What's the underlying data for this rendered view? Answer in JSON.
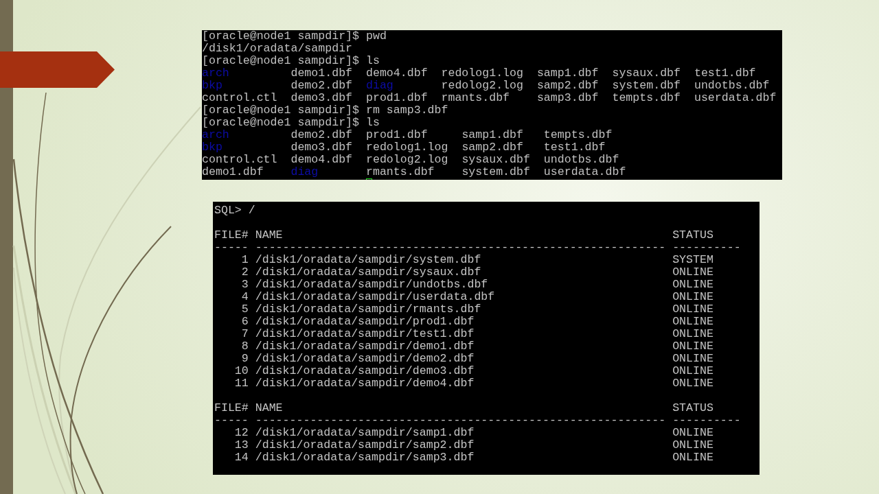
{
  "terminal": {
    "lines": [
      {
        "kind": "text",
        "text": "[oracle@node1 sampdir]$ pwd"
      },
      {
        "kind": "text",
        "text": "/disk1/oradata/sampdir"
      },
      {
        "kind": "text",
        "text": "[oracle@node1 sampdir]$ ls"
      },
      {
        "kind": "listing",
        "rows": [
          [
            {
              "name": "arch",
              "kind": "directory"
            },
            {
              "name": "demo1.dbf",
              "kind": "file"
            },
            {
              "name": "demo4.dbf",
              "kind": "file"
            },
            {
              "name": "redolog1.log",
              "kind": "file"
            },
            {
              "name": "samp1.dbf",
              "kind": "file"
            },
            {
              "name": "sysaux.dbf",
              "kind": "file"
            },
            {
              "name": "test1.dbf",
              "kind": "file"
            }
          ],
          [
            {
              "name": "bkp",
              "kind": "directory"
            },
            {
              "name": "demo2.dbf",
              "kind": "file"
            },
            {
              "name": "diag",
              "kind": "directory"
            },
            {
              "name": "redolog2.log",
              "kind": "file"
            },
            {
              "name": "samp2.dbf",
              "kind": "file"
            },
            {
              "name": "system.dbf",
              "kind": "file"
            },
            {
              "name": "undotbs.dbf",
              "kind": "file"
            }
          ],
          [
            {
              "name": "control.ctl",
              "kind": "file"
            },
            {
              "name": "demo3.dbf",
              "kind": "file"
            },
            {
              "name": "prod1.dbf",
              "kind": "file"
            },
            {
              "name": "rmants.dbf",
              "kind": "file"
            },
            {
              "name": "samp3.dbf",
              "kind": "file"
            },
            {
              "name": "tempts.dbf",
              "kind": "file"
            },
            {
              "name": "userdata.dbf",
              "kind": "file"
            }
          ]
        ]
      },
      {
        "kind": "text",
        "text": "[oracle@node1 sampdir]$ rm samp3.dbf"
      },
      {
        "kind": "text",
        "text": "[oracle@node1 sampdir]$ ls"
      },
      {
        "kind": "listing",
        "rows": [
          [
            {
              "name": "arch",
              "kind": "directory"
            },
            {
              "name": "demo2.dbf",
              "kind": "file"
            },
            {
              "name": "prod1.dbf",
              "kind": "file"
            },
            {
              "name": "samp1.dbf",
              "kind": "file"
            },
            {
              "name": "tempts.dbf",
              "kind": "file"
            }
          ],
          [
            {
              "name": "bkp",
              "kind": "directory"
            },
            {
              "name": "demo3.dbf",
              "kind": "file"
            },
            {
              "name": "redolog1.log",
              "kind": "file"
            },
            {
              "name": "samp2.dbf",
              "kind": "file"
            },
            {
              "name": "test1.dbf",
              "kind": "file"
            }
          ],
          [
            {
              "name": "control.ctl",
              "kind": "file"
            },
            {
              "name": "demo4.dbf",
              "kind": "file"
            },
            {
              "name": "redolog2.log",
              "kind": "file"
            },
            {
              "name": "sysaux.dbf",
              "kind": "file"
            },
            {
              "name": "undotbs.dbf",
              "kind": "file"
            }
          ],
          [
            {
              "name": "demo1.dbf",
              "kind": "file"
            },
            {
              "name": "diag",
              "kind": "directory"
            },
            {
              "name": "rmants.dbf",
              "kind": "file"
            },
            {
              "name": "system.dbf",
              "kind": "file"
            },
            {
              "name": "userdata.dbf",
              "kind": "file"
            }
          ]
        ]
      },
      {
        "kind": "cursor"
      }
    ]
  },
  "sql": {
    "prompt": "SQL> /",
    "result_blocks": [
      {
        "headers": {
          "file_no": "FILE#",
          "name": "NAME",
          "status": "STATUS"
        },
        "rules": {
          "file_no": "-----",
          "name": "------------------------------------------------------------",
          "status": "----------"
        },
        "rows": [
          {
            "file_no": "1",
            "name": "/disk1/oradata/sampdir/system.dbf",
            "status": "SYSTEM"
          },
          {
            "file_no": "2",
            "name": "/disk1/oradata/sampdir/sysaux.dbf",
            "status": "ONLINE"
          },
          {
            "file_no": "3",
            "name": "/disk1/oradata/sampdir/undotbs.dbf",
            "status": "ONLINE"
          },
          {
            "file_no": "4",
            "name": "/disk1/oradata/sampdir/userdata.dbf",
            "status": "ONLINE"
          },
          {
            "file_no": "5",
            "name": "/disk1/oradata/sampdir/rmants.dbf",
            "status": "ONLINE"
          },
          {
            "file_no": "6",
            "name": "/disk1/oradata/sampdir/prod1.dbf",
            "status": "ONLINE"
          },
          {
            "file_no": "7",
            "name": "/disk1/oradata/sampdir/test1.dbf",
            "status": "ONLINE"
          },
          {
            "file_no": "8",
            "name": "/disk1/oradata/sampdir/demo1.dbf",
            "status": "ONLINE"
          },
          {
            "file_no": "9",
            "name": "/disk1/oradata/sampdir/demo2.dbf",
            "status": "ONLINE"
          },
          {
            "file_no": "10",
            "name": "/disk1/oradata/sampdir/demo3.dbf",
            "status": "ONLINE"
          },
          {
            "file_no": "11",
            "name": "/disk1/oradata/sampdir/demo4.dbf",
            "status": "ONLINE"
          }
        ]
      },
      {
        "headers": {
          "file_no": "FILE#",
          "name": "NAME",
          "status": "STATUS"
        },
        "rules": {
          "file_no": "-----",
          "name": "------------------------------------------------------------",
          "status": "----------"
        },
        "rows": [
          {
            "file_no": "12",
            "name": "/disk1/oradata/sampdir/samp1.dbf",
            "status": "ONLINE"
          },
          {
            "file_no": "13",
            "name": "/disk1/oradata/sampdir/samp2.dbf",
            "status": "ONLINE"
          },
          {
            "file_no": "14",
            "name": "/disk1/oradata/sampdir/samp3.dbf",
            "status": "ONLINE"
          }
        ]
      }
    ]
  }
}
